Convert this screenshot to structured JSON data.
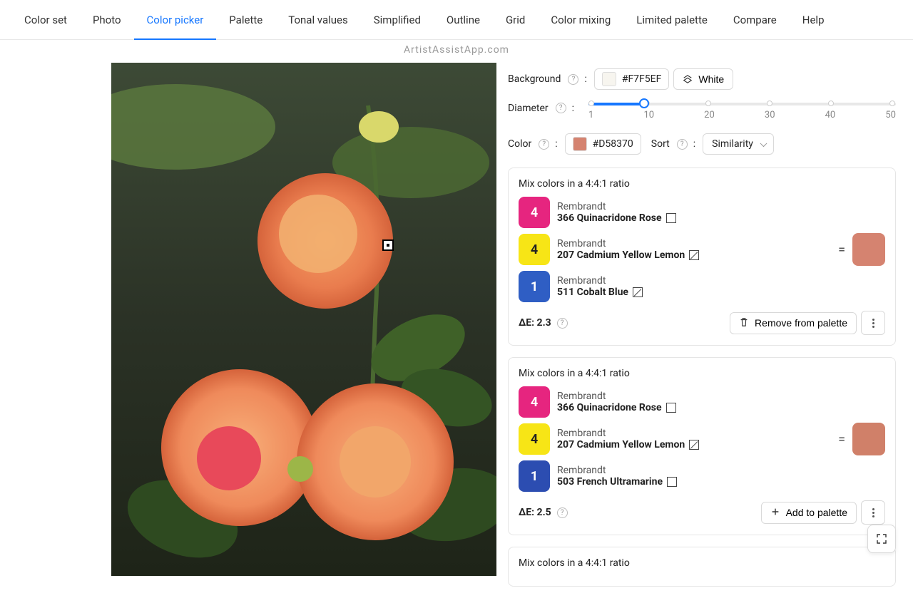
{
  "nav": {
    "items": [
      "Color set",
      "Photo",
      "Color picker",
      "Palette",
      "Tonal values",
      "Simplified",
      "Outline",
      "Grid",
      "Color mixing",
      "Limited palette",
      "Compare",
      "Help"
    ],
    "active_index": 2
  },
  "watermark": "ArtistAssistApp.com",
  "controls": {
    "background_label": "Background",
    "background_hex": "#F7F5EF",
    "white_button": "White",
    "diameter_label": "Diameter",
    "diameter_marks": [
      "1",
      "10",
      "20",
      "30",
      "40",
      "50"
    ],
    "diameter_value": 10,
    "color_label": "Color",
    "color_hex": "#D58370",
    "sort_label": "Sort",
    "sort_value": "Similarity"
  },
  "results": [
    {
      "ratio_text": "Mix colors in a 4:4:1 ratio",
      "components": [
        {
          "ratio": "4",
          "brand": "Rembrandt",
          "name": "366 Quinacridone Rose",
          "badge_color": "#E6257F",
          "icon": "square"
        },
        {
          "ratio": "4",
          "brand": "Rembrandt",
          "name": "207 Cadmium Yellow Lemon",
          "badge_color": "#F7E516",
          "badge_text_dark": true,
          "icon": "diag"
        },
        {
          "ratio": "1",
          "brand": "Rembrandt",
          "name": "511 Cobalt Blue",
          "badge_color": "#2F5EC4",
          "icon": "diag"
        }
      ],
      "result_color": "#D58370",
      "delta_e": "ΔE: 2.3",
      "action": "Remove from palette",
      "action_icon": "trash"
    },
    {
      "ratio_text": "Mix colors in a 4:4:1 ratio",
      "components": [
        {
          "ratio": "4",
          "brand": "Rembrandt",
          "name": "366 Quinacridone Rose",
          "badge_color": "#E6257F",
          "icon": "square"
        },
        {
          "ratio": "4",
          "brand": "Rembrandt",
          "name": "207 Cadmium Yellow Lemon",
          "badge_color": "#F7E516",
          "badge_text_dark": true,
          "icon": "diag"
        },
        {
          "ratio": "1",
          "brand": "Rembrandt",
          "name": "503 French Ultramarine",
          "badge_color": "#2C4DB1",
          "icon": "square"
        }
      ],
      "result_color": "#D08069",
      "delta_e": "ΔE: 2.5",
      "action": "Add to palette",
      "action_icon": "plus"
    },
    {
      "ratio_text": "Mix colors in a 4:4:1 ratio",
      "components": [],
      "result_color": "#D58370",
      "delta_e": "",
      "action": "",
      "action_icon": ""
    }
  ],
  "equals": "="
}
